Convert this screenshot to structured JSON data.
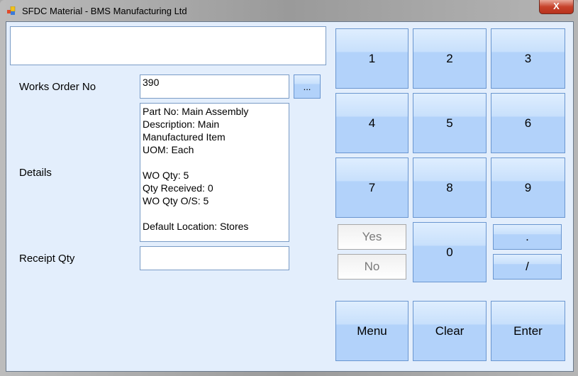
{
  "window": {
    "title": "SFDC Material - BMS Manufacturing Ltd",
    "close_label": "X"
  },
  "form": {
    "message": "",
    "works_order_label": "Works Order No",
    "works_order_value": "390",
    "lookup_label": "...",
    "details_label": "Details",
    "details_lines": [
      "Part No: Main Assembly",
      "Description: Main",
      "Manufactured Item",
      "UOM: Each",
      "",
      "WO Qty: 5",
      "Qty Received: 0",
      "WO Qty O/S: 5",
      "",
      "Default Location: Stores"
    ],
    "receipt_qty_label": "Receipt Qty",
    "receipt_qty_value": ""
  },
  "keypad": {
    "keys": [
      "1",
      "2",
      "3",
      "4",
      "5",
      "6",
      "7",
      "8",
      "9"
    ],
    "zero": "0",
    "dot": ".",
    "slash": "/",
    "yes": "Yes",
    "no": "No",
    "menu": "Menu",
    "clear": "Clear",
    "enter": "Enter"
  }
}
